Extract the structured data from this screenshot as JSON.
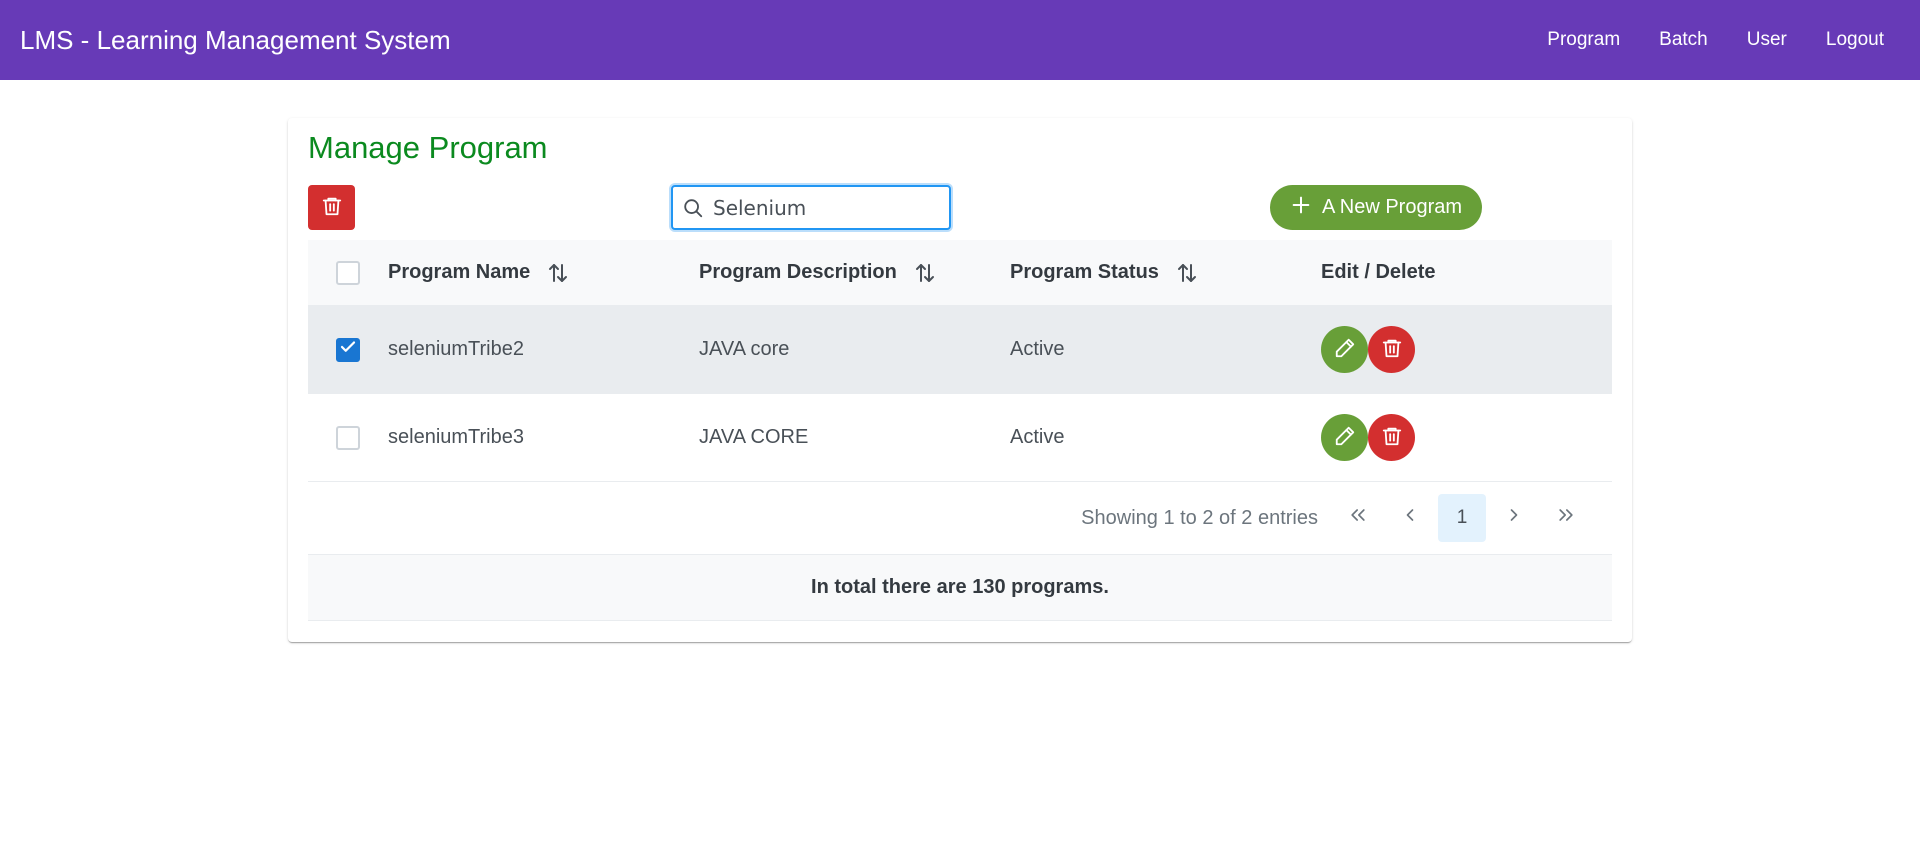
{
  "app": {
    "title": "LMS - Learning Management System"
  },
  "nav": {
    "items": [
      "Program",
      "Batch",
      "User",
      "Logout"
    ]
  },
  "page": {
    "title": "Manage Program"
  },
  "search": {
    "value": "Selenium"
  },
  "new_button": {
    "label": "A New Program"
  },
  "table": {
    "headers": [
      "Program Name",
      "Program Description",
      "Program Status",
      "Edit / Delete"
    ],
    "rows": [
      {
        "name": "seleniumTribe2",
        "description": "JAVA core",
        "status": "Active",
        "selected": true
      },
      {
        "name": "seleniumTribe3",
        "description": "JAVA CORE",
        "status": "Active",
        "selected": false
      }
    ]
  },
  "pagination": {
    "report": "Showing 1 to 2 of 2 entries",
    "current_page": "1"
  },
  "footer": {
    "text": "In total there are 130 programs."
  },
  "colors": {
    "header": "#673ab7",
    "title": "#0b8a1f",
    "success": "#689f38",
    "danger": "#d32f2f",
    "selected_row": "#e9ecef"
  },
  "icons": [
    "trash-icon",
    "search-icon",
    "plus-icon",
    "sort-icon",
    "pencil-icon",
    "check-icon",
    "double-chevron-left-icon",
    "chevron-left-icon",
    "chevron-right-icon",
    "double-chevron-right-icon"
  ]
}
